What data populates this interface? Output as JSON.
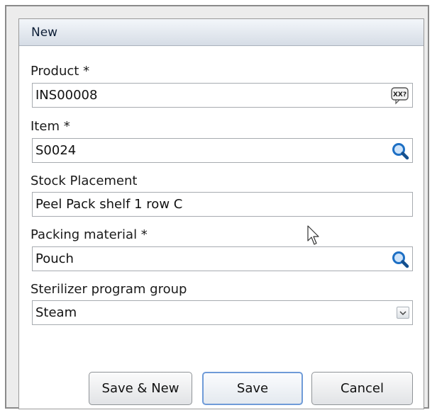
{
  "dialog": {
    "title": "New"
  },
  "form": {
    "product": {
      "label": "Product *",
      "value": "INS00008"
    },
    "item": {
      "label": "Item *",
      "value": "S0024"
    },
    "stock_placement": {
      "label": "Stock Placement",
      "value": "Peel Pack shelf 1 row C"
    },
    "packing_material": {
      "label": "Packing material *",
      "value": "Pouch"
    },
    "sterilizer_program_group": {
      "label": "Sterilizer program group",
      "value": "Steam"
    }
  },
  "icons": {
    "product_lookup": "XX?",
    "item_search": "search-icon",
    "packing_search": "search-icon",
    "dropdown": "chevron-down-icon"
  },
  "buttons": {
    "save_new": "Save & New",
    "save": "Save",
    "cancel": "Cancel"
  },
  "colors": {
    "header_text": "#0e1f37",
    "search_icon": "#1d6fc4",
    "primary_border": "#6f9bd8"
  }
}
